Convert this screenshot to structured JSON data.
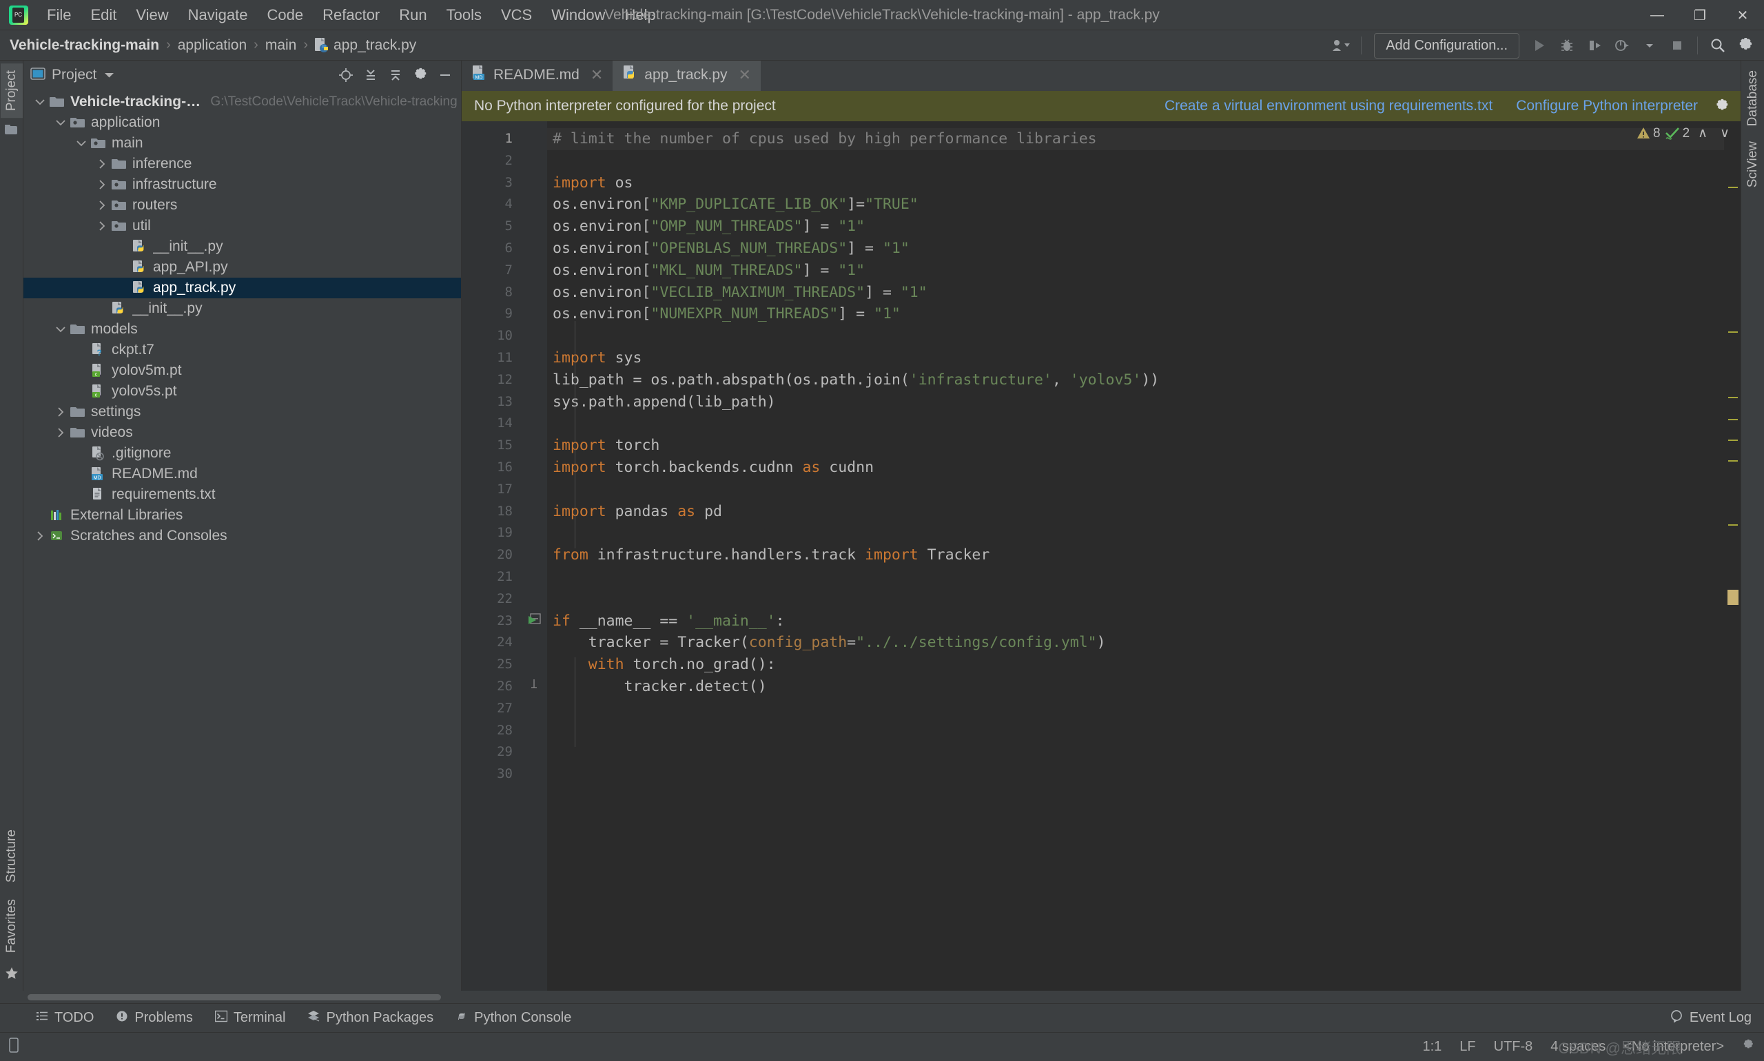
{
  "window": {
    "title": "Vehicle-tracking-main [G:\\TestCode\\VehicleTrack\\Vehicle-tracking-main] - app_track.py",
    "minimize": "—",
    "maximize": "❐",
    "close": "✕"
  },
  "menu": {
    "items": [
      "File",
      "Edit",
      "View",
      "Navigate",
      "Code",
      "Refactor",
      "Run",
      "Tools",
      "VCS",
      "Window",
      "Help"
    ]
  },
  "breadcrumb": {
    "items": [
      "Vehicle-tracking-main",
      "application",
      "main",
      "app_track.py"
    ],
    "separator": "›"
  },
  "toolbar": {
    "add_configuration": "Add Configuration...",
    "icons": [
      "user-group-icon",
      "run-icon",
      "debug-icon",
      "run-coverage-icon",
      "profile-icon",
      "stop-icon",
      "search-everywhere-icon",
      "settings-icon"
    ]
  },
  "project_panel": {
    "title": "Project",
    "tools": [
      "locate-icon",
      "collapse-all-icon",
      "expand-all-icon",
      "settings-icon",
      "hide-icon"
    ],
    "tree": [
      {
        "label": "Vehicle-tracking-main",
        "path": "G:\\TestCode\\VehicleTrack\\Vehicle-tracking-main",
        "depth": 0,
        "arrow": "down",
        "icon": "folder-icon",
        "bold": true,
        "selected": false
      },
      {
        "label": "application",
        "path": "",
        "depth": 1,
        "arrow": "down",
        "icon": "source-folder-icon",
        "bold": false,
        "selected": false
      },
      {
        "label": "main",
        "path": "",
        "depth": 2,
        "arrow": "down",
        "icon": "source-folder-icon",
        "bold": false,
        "selected": false
      },
      {
        "label": "inference",
        "path": "",
        "depth": 3,
        "arrow": "right",
        "icon": "folder-icon",
        "bold": false,
        "selected": false
      },
      {
        "label": "infrastructure",
        "path": "",
        "depth": 3,
        "arrow": "right",
        "icon": "source-folder-icon",
        "bold": false,
        "selected": false
      },
      {
        "label": "routers",
        "path": "",
        "depth": 3,
        "arrow": "right",
        "icon": "source-folder-icon",
        "bold": false,
        "selected": false
      },
      {
        "label": "util",
        "path": "",
        "depth": 3,
        "arrow": "right",
        "icon": "source-folder-icon",
        "bold": false,
        "selected": false
      },
      {
        "label": "__init__.py",
        "path": "",
        "depth": 4,
        "arrow": "none",
        "icon": "python-file-icon",
        "bold": false,
        "selected": false
      },
      {
        "label": "app_API.py",
        "path": "",
        "depth": 4,
        "arrow": "none",
        "icon": "python-file-icon",
        "bold": false,
        "selected": false
      },
      {
        "label": "app_track.py",
        "path": "",
        "depth": 4,
        "arrow": "none",
        "icon": "python-file-icon",
        "bold": false,
        "selected": true
      },
      {
        "label": "__init__.py",
        "path": "",
        "depth": 3,
        "arrow": "none",
        "icon": "python-file-icon",
        "bold": false,
        "selected": false
      },
      {
        "label": "models",
        "path": "",
        "depth": 1,
        "arrow": "down",
        "icon": "folder-icon",
        "bold": false,
        "selected": false
      },
      {
        "label": "ckpt.t7",
        "path": "",
        "depth": 2,
        "arrow": "none",
        "icon": "unknown-file-icon",
        "bold": false,
        "selected": false
      },
      {
        "label": "yolov5m.pt",
        "path": "",
        "depth": 2,
        "arrow": "none",
        "icon": "c-file-icon",
        "bold": false,
        "selected": false
      },
      {
        "label": "yolov5s.pt",
        "path": "",
        "depth": 2,
        "arrow": "none",
        "icon": "c-file-icon",
        "bold": false,
        "selected": false
      },
      {
        "label": "settings",
        "path": "",
        "depth": 1,
        "arrow": "right",
        "icon": "folder-icon",
        "bold": false,
        "selected": false
      },
      {
        "label": "videos",
        "path": "",
        "depth": 1,
        "arrow": "right",
        "icon": "folder-icon",
        "bold": false,
        "selected": false
      },
      {
        "label": ".gitignore",
        "path": "",
        "depth": 2,
        "arrow": "none",
        "icon": "gitignore-file-icon",
        "bold": false,
        "selected": false
      },
      {
        "label": "README.md",
        "path": "",
        "depth": 2,
        "arrow": "none",
        "icon": "markdown-file-icon",
        "bold": false,
        "selected": false
      },
      {
        "label": "requirements.txt",
        "path": "",
        "depth": 2,
        "arrow": "none",
        "icon": "text-file-icon",
        "bold": false,
        "selected": false
      },
      {
        "label": "External Libraries",
        "path": "",
        "depth": 0,
        "arrow": "none",
        "icon": "libraries-icon",
        "bold": false,
        "selected": false
      },
      {
        "label": "Scratches and Consoles",
        "path": "",
        "depth": 0,
        "arrow": "right",
        "icon": "scratches-icon",
        "bold": false,
        "selected": false
      }
    ]
  },
  "left_strip": {
    "tabs": [
      "Project",
      "Structure",
      "Favorites"
    ]
  },
  "right_strip": {
    "tabs": [
      "Database",
      "SciView"
    ]
  },
  "editor_tabs": [
    {
      "label": "README.md",
      "icon": "markdown-file-icon",
      "active": false,
      "close": "✕"
    },
    {
      "label": "app_track.py",
      "icon": "python-file-icon",
      "active": true,
      "close": "✕"
    }
  ],
  "notification": {
    "message": "No Python interpreter configured for the project",
    "link1": "Create a virtual environment using requirements.txt",
    "link2": "Configure Python interpreter",
    "gear": "gear-icon"
  },
  "inspections": {
    "warning_count": "8",
    "ok_count": "2",
    "up": "∧",
    "down": "∨"
  },
  "code": {
    "language": "python",
    "first_line": 1,
    "last_line": 30,
    "lines": [
      {
        "n": 1,
        "text": "# limit the number of cpus used by high performance libraries"
      },
      {
        "n": 2,
        "text": ""
      },
      {
        "n": 3,
        "text": "import os"
      },
      {
        "n": 4,
        "text": "os.environ[\"KMP_DUPLICATE_LIB_OK\"]=\"TRUE\""
      },
      {
        "n": 5,
        "text": "os.environ[\"OMP_NUM_THREADS\"] = \"1\""
      },
      {
        "n": 6,
        "text": "os.environ[\"OPENBLAS_NUM_THREADS\"] = \"1\""
      },
      {
        "n": 7,
        "text": "os.environ[\"MKL_NUM_THREADS\"] = \"1\""
      },
      {
        "n": 8,
        "text": "os.environ[\"VECLIB_MAXIMUM_THREADS\"] = \"1\""
      },
      {
        "n": 9,
        "text": "os.environ[\"NUMEXPR_NUM_THREADS\"] = \"1\""
      },
      {
        "n": 10,
        "text": ""
      },
      {
        "n": 11,
        "text": "import sys"
      },
      {
        "n": 12,
        "text": "lib_path = os.path.abspath(os.path.join('infrastructure', 'yolov5'))"
      },
      {
        "n": 13,
        "text": "sys.path.append(lib_path)"
      },
      {
        "n": 14,
        "text": ""
      },
      {
        "n": 15,
        "text": "import torch"
      },
      {
        "n": 16,
        "text": "import torch.backends.cudnn as cudnn"
      },
      {
        "n": 17,
        "text": ""
      },
      {
        "n": 18,
        "text": "import pandas as pd"
      },
      {
        "n": 19,
        "text": ""
      },
      {
        "n": 20,
        "text": "from infrastructure.handlers.track import Tracker"
      },
      {
        "n": 21,
        "text": ""
      },
      {
        "n": 22,
        "text": ""
      },
      {
        "n": 23,
        "text": "if __name__ == '__main__':"
      },
      {
        "n": 24,
        "text": "    tracker = Tracker(config_path=\"../../settings/config.yml\")"
      },
      {
        "n": 25,
        "text": "    with torch.no_grad():"
      },
      {
        "n": 26,
        "text": "        tracker.detect()"
      },
      {
        "n": 27,
        "text": ""
      },
      {
        "n": 28,
        "text": ""
      },
      {
        "n": 29,
        "text": ""
      },
      {
        "n": 30,
        "text": ""
      }
    ]
  },
  "bottom_tools": [
    {
      "label": "TODO",
      "icon": "todo-icon"
    },
    {
      "label": "Problems",
      "icon": "problems-icon"
    },
    {
      "label": "Terminal",
      "icon": "terminal-icon"
    },
    {
      "label": "Python Packages",
      "icon": "packages-icon"
    },
    {
      "label": "Python Console",
      "icon": "python-console-icon"
    }
  ],
  "event_log": {
    "label": "Event Log",
    "icon": "event-log-icon"
  },
  "status": {
    "caret": "1:1",
    "line_separator": "LF",
    "encoding": "UTF-8",
    "indent": "4 spaces",
    "interpreter": "<No interpreter>"
  },
  "watermark": "CSDN @思绪无限",
  "colors": {
    "accent_blue": "#6aa2e8",
    "notification_bg": "#4f5229",
    "selection_bg": "#0d293e",
    "editor_bg": "#2b2b2b",
    "panel_bg": "#3c3f41",
    "keyword": "#cc7832",
    "string": "#6a8759",
    "comment": "#808080",
    "param": "#aa7a43"
  }
}
